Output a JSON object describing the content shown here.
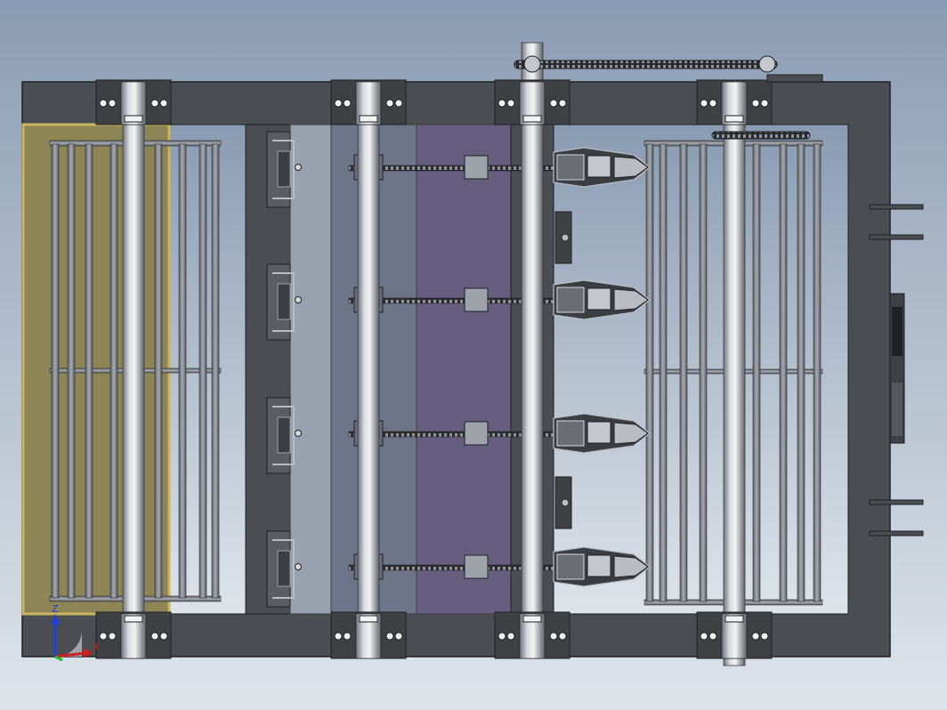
{
  "viewport": {
    "background_top": "#8a9cb3",
    "background_bottom": "#dfe4ea"
  },
  "colors": {
    "frame": "#4a4d51",
    "frame_edge": "#1e2023",
    "rod": "#d7dadd",
    "rod_dark": "#7b8088",
    "bearing": "#3e4144",
    "bearing_light": "#f1f2f3",
    "wood_panel": "#8e8557",
    "wood_edge": "#cbb55c",
    "cage_bar": "#7f8389",
    "blue_panel": "#6e7588",
    "purple_panel": "#655e7f",
    "light_panel": "#9aa1ae",
    "chain": "#2a2c30",
    "blade": "#b9bdc3"
  },
  "triad": {
    "z_label": "Z",
    "x_label": "X",
    "z_color": "#1f3fd8",
    "x_color": "#d21f1f",
    "y_color": "#1fbf2a",
    "icon": "coordinate-triad-icon"
  },
  "counts": {
    "rows": 4,
    "shafts": 4
  }
}
